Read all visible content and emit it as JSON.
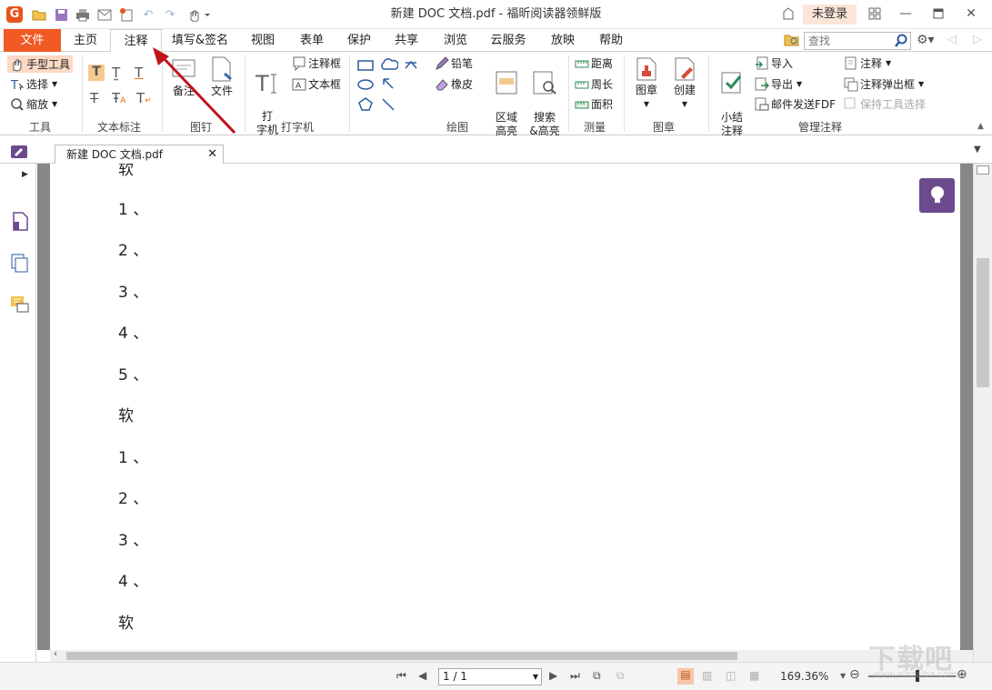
{
  "window": {
    "title": "新建 DOC 文档.pdf - 福昕阅读器领鲜版",
    "login": "未登录"
  },
  "menu_tabs": [
    "文件",
    "主页",
    "注释",
    "填写&签名",
    "视图",
    "表单",
    "保护",
    "共享",
    "浏览",
    "云服务",
    "放映",
    "帮助"
  ],
  "active_tab": "注释",
  "search": {
    "placeholder": "查找"
  },
  "ribbon": {
    "tools": {
      "hand": "手型工具",
      "select": "选择",
      "zoom": "缩放",
      "label": "工具"
    },
    "text_markup": {
      "label": "文本标注"
    },
    "pin": {
      "note": "备注",
      "file": "文件",
      "label": "图钉"
    },
    "typewriter": {
      "typewriter": "打\n字机",
      "callout": "注释框",
      "textbox": "文本框",
      "label": "打字机"
    },
    "drawing": {
      "pencil": "铅笔",
      "eraser": "橡皮",
      "area_highlight": "区域\n高亮",
      "search_highlight": "搜索\n&高亮",
      "label": "绘图"
    },
    "measure": {
      "distance": "距离",
      "perimeter": "周长",
      "area": "面积",
      "label": "测量"
    },
    "stamp": {
      "stamp": "图章",
      "create": "创建",
      "label": "图章"
    },
    "manage": {
      "summarize": "小结\n注释",
      "import": "导入",
      "export": "导出",
      "email_fdf": "邮件发送FDF",
      "comment": "注释",
      "popup": "注释弹出框",
      "keep_tool": "保持工具选择",
      "label": "管理注释"
    }
  },
  "document_tab": "新建 DOC 文档.pdf",
  "document_lines": [
    "软",
    "1 、",
    "2 、",
    "3 、",
    "4 、",
    "5 、",
    "软",
    "1 、",
    "2 、",
    "3 、",
    "4 、",
    "软"
  ],
  "statusbar": {
    "page": "1 / 1",
    "zoom": "169.36%"
  },
  "watermark": {
    "text": "下载吧",
    "url": "www.xiazaiba.com"
  },
  "colors": {
    "accent": "#f15a24",
    "bulb": "#6b4a8e",
    "arrow": "#c0141a"
  }
}
